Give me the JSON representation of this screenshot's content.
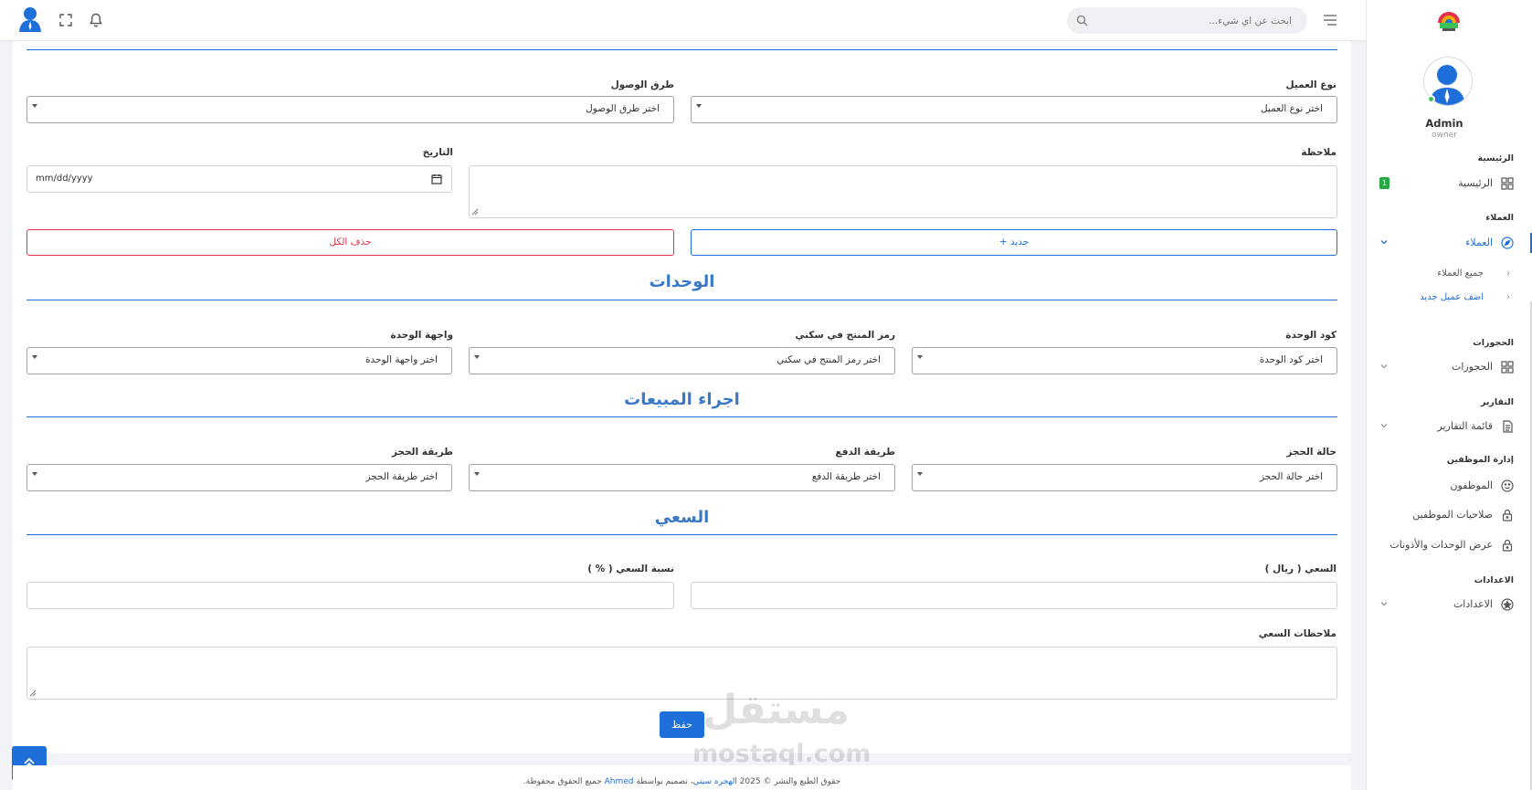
{
  "topbar": {
    "search_placeholder": "ابحث عن اي شيء..."
  },
  "sidebar": {
    "profile_name": "Admin",
    "profile_role": "owner",
    "sections": {
      "home": "الرئيسية",
      "clients": "العملاء",
      "bookings": "الحجوزات",
      "reports": "التقارير",
      "staff": "إدارة الموظفين",
      "settings": "الاعدادات"
    },
    "items": {
      "home": "الرئيسية",
      "home_badge": "1",
      "clients": "العملاء",
      "all_clients": "جميع العملاء",
      "add_client": "اضف عميل جديد",
      "bookings": "الحجوزات",
      "reports_list": "قائمة التقارير",
      "employees": "الموظفون",
      "employee_permissions": "صلاحيات الموظفين",
      "units_permissions": "عرض الوحدات والأذونات",
      "settings": "الاعدادات"
    }
  },
  "form": {
    "client_type_label": "نوع العميل",
    "client_type_value": "اختر نوع العميل",
    "access_method_label": "طرق الوصول",
    "access_method_value": "اختر طرق الوصول",
    "note_label": "ملاحظة",
    "date_label": "التاريخ",
    "date_placeholder": "mm/dd/yyyy",
    "new_button": "جديد +",
    "delete_all_button": "حذف الكل",
    "units_title": "الوحدات",
    "unit_code_label": "كود الوحدة",
    "unit_code_value": "اختر كود الوحدة",
    "sku_label": "رمز المنتج في سكني",
    "sku_value": "اختر رمز المنتج في سكني",
    "unit_facade_label": "واجهة الوحدة",
    "unit_facade_value": "اختر واجهة الوحدة",
    "sales_title": "اجراء المبيعات",
    "booking_status_label": "حالة الحجز",
    "booking_status_value": "اختر حالة الحجز",
    "payment_method_label": "طريقة الدفع",
    "payment_method_value": "اختر طريقة الدفع",
    "booking_method_label": "طريقة الحجز",
    "booking_method_value": "اختر طريقة الحجز",
    "commission_title": "السعي",
    "commission_amount_label": "السعي ( ريال )",
    "commission_percent_label": "نسبة السعي ( % )",
    "commission_notes_label": "ملاحظات السعي",
    "save_button": "حفظ"
  },
  "watermark": {
    "arabic": "مستقل",
    "latin": "mostaql.com"
  },
  "footer": {
    "part1": "حقوق الطبع والنشر © 2025",
    "brand": "الهجره سيتي",
    "part2": "، تصميم بواسطة",
    "author": "Ahmed",
    "part3": "جميع الحقوق محفوظة."
  },
  "colors": {
    "accent": "#1e6fd9",
    "danger": "#e0324a",
    "section_title": "#3b78c5",
    "badge": "#28a745"
  }
}
